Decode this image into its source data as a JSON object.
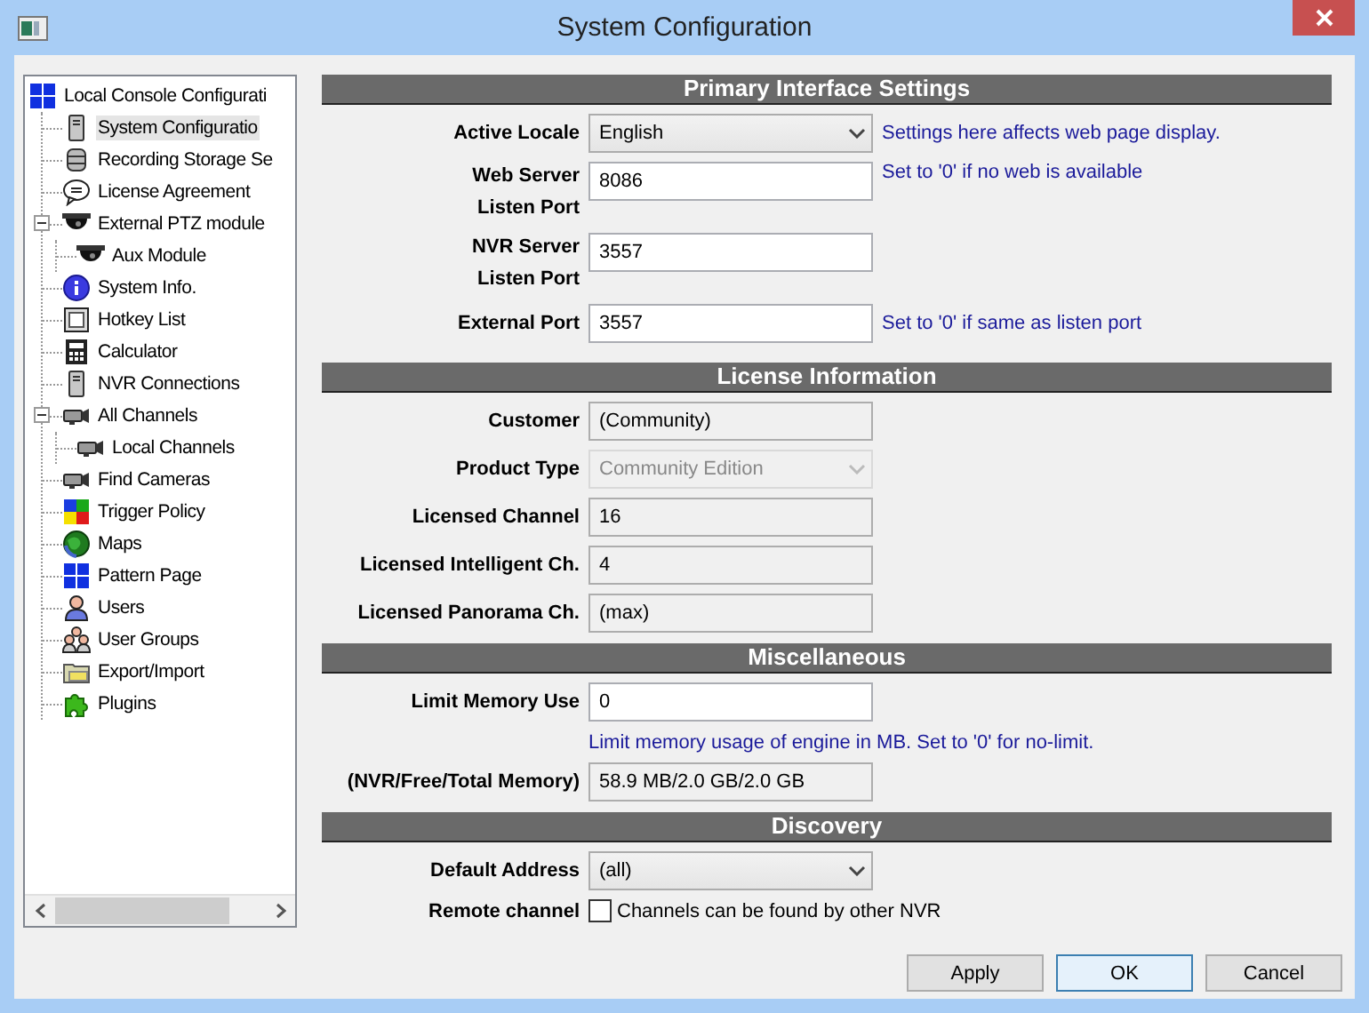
{
  "window": {
    "title": "System Configuration"
  },
  "tree": {
    "items": [
      {
        "label": "Local Console Configurati",
        "selected": false,
        "children": [
          {
            "label": "System Configuratio",
            "selected": true
          },
          {
            "label": "Recording Storage Se",
            "selected": false
          },
          {
            "label": "License Agreement",
            "selected": false
          },
          {
            "label": "External PTZ module",
            "selected": false,
            "expanded": true,
            "children": [
              {
                "label": "Aux Module",
                "selected": false
              }
            ]
          },
          {
            "label": "System Info.",
            "selected": false
          },
          {
            "label": "Hotkey List",
            "selected": false
          },
          {
            "label": "Calculator",
            "selected": false
          },
          {
            "label": "NVR Connections",
            "selected": false
          },
          {
            "label": "All Channels",
            "selected": false,
            "expanded": true,
            "children": [
              {
                "label": "Local Channels",
                "selected": false
              }
            ]
          },
          {
            "label": "Find Cameras",
            "selected": false
          },
          {
            "label": "Trigger Policy",
            "selected": false
          },
          {
            "label": "Maps",
            "selected": false
          },
          {
            "label": "Pattern Page",
            "selected": false
          },
          {
            "label": "Users",
            "selected": false
          },
          {
            "label": "User Groups",
            "selected": false
          },
          {
            "label": "Export/Import",
            "selected": false
          },
          {
            "label": "Plugins",
            "selected": false
          }
        ]
      }
    ]
  },
  "sections": [
    {
      "title": "Primary Interface Settings",
      "rows": [
        {
          "kind": "select",
          "label": "Active Locale",
          "value": "English",
          "disabled": false,
          "hint": "Settings here affects web page display."
        },
        {
          "kind": "input",
          "label": "Web Server\nListen Port",
          "value": "8086",
          "hint": "Set to '0' if no web is available"
        },
        {
          "kind": "input",
          "label": "NVR Server\nListen Port",
          "value": "3557"
        },
        {
          "kind": "input",
          "label": "External Port",
          "value": "3557",
          "hint": "Set to '0' if same as listen port"
        }
      ]
    },
    {
      "title": "License Information",
      "rows": [
        {
          "kind": "readonly",
          "label": "Customer",
          "value": "(Community)"
        },
        {
          "kind": "select",
          "label": "Product Type",
          "value": "Community Edition",
          "disabled": true
        },
        {
          "kind": "readonly",
          "label": "Licensed Channel",
          "value": "16"
        },
        {
          "kind": "readonly",
          "label": "Licensed Intelligent Ch.",
          "value": "4"
        },
        {
          "kind": "readonly",
          "label": "Licensed Panorama Ch.",
          "value": "(max)"
        }
      ]
    },
    {
      "title": "Miscellaneous",
      "rows": [
        {
          "kind": "input",
          "label": "Limit Memory Use",
          "value": "0"
        },
        {
          "kind": "note",
          "text": "Limit memory usage of engine in MB. Set to '0' for no-limit."
        },
        {
          "kind": "readonly",
          "label": "(NVR/Free/Total Memory)",
          "value": "58.9 MB/2.0 GB/2.0 GB"
        }
      ]
    },
    {
      "title": "Discovery",
      "rows": [
        {
          "kind": "select",
          "label": "Default Address",
          "value": "(all)",
          "disabled": false
        },
        {
          "kind": "checkbox",
          "label": "Remote channel",
          "text": "Channels can be found by other NVR",
          "checked": false
        }
      ]
    }
  ],
  "buttons": [
    {
      "label": "Apply",
      "focused": false
    },
    {
      "label": "OK",
      "focused": true
    },
    {
      "label": "Cancel",
      "focused": false
    }
  ]
}
